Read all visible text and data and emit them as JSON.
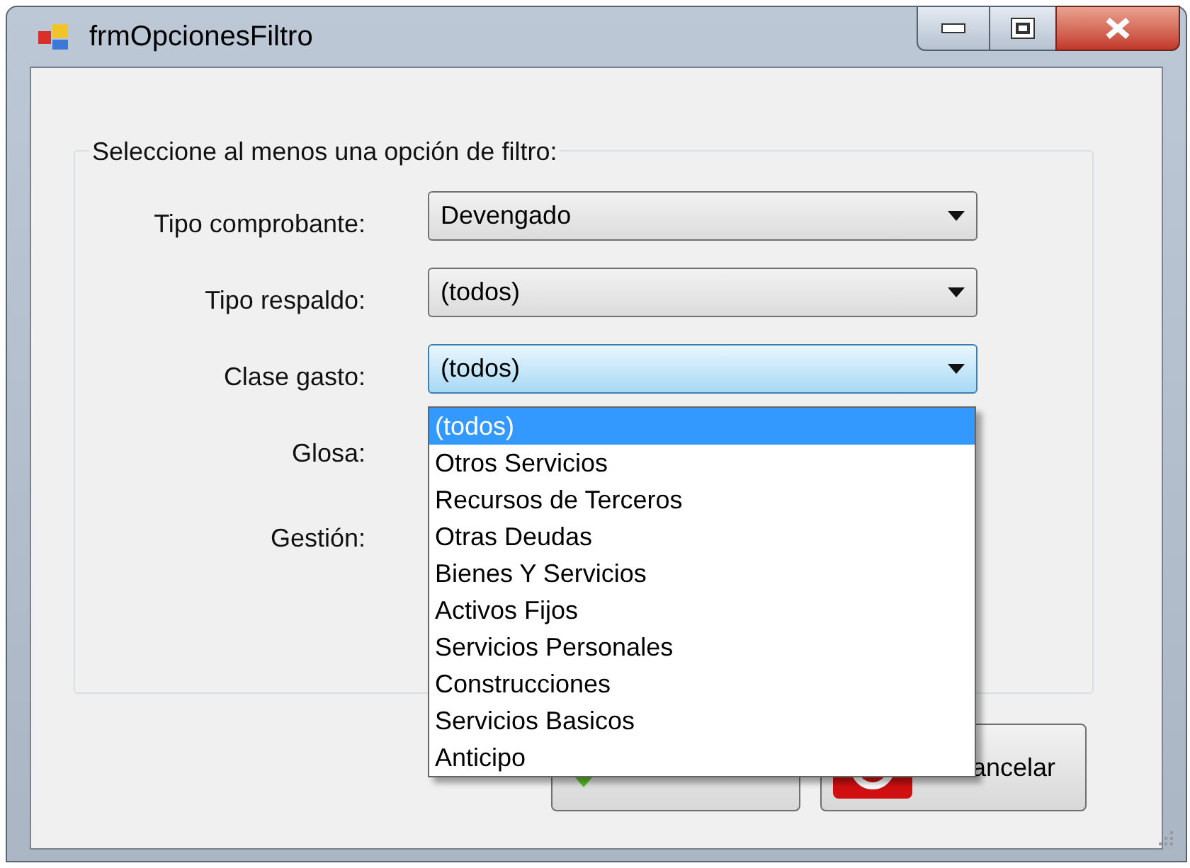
{
  "window": {
    "title": "frmOpcionesFiltro"
  },
  "group": {
    "title": "Seleccione al menos una opción de filtro:"
  },
  "fields": [
    {
      "label": "Tipo comprobante:",
      "kind": "combo",
      "value": "Devengado",
      "focused": false
    },
    {
      "label": "Tipo respaldo:",
      "kind": "combo",
      "value": "(todos)",
      "focused": false
    },
    {
      "label": "Clase gasto:",
      "kind": "combo",
      "value": "(todos)",
      "focused": true
    },
    {
      "label": "Glosa:",
      "kind": "hidden"
    },
    {
      "label": "Gestión:",
      "kind": "hidden"
    }
  ],
  "dropdown": {
    "options": [
      {
        "label": "(todos)",
        "selected": true
      },
      {
        "label": "Otros Servicios",
        "selected": false
      },
      {
        "label": "Recursos de Terceros",
        "selected": false
      },
      {
        "label": "Otras Deudas",
        "selected": false
      },
      {
        "label": "Bienes Y Servicios",
        "selected": false
      },
      {
        "label": "Activos Fijos",
        "selected": false
      },
      {
        "label": "Servicios Personales",
        "selected": false
      },
      {
        "label": "Construcciones",
        "selected": false
      },
      {
        "label": "Servicios Basicos",
        "selected": false
      },
      {
        "label": "Anticipo",
        "selected": false
      }
    ]
  },
  "buttons": [
    {
      "kind": "accept"
    },
    {
      "kind": "cancel",
      "label": "ancelar"
    }
  ]
}
